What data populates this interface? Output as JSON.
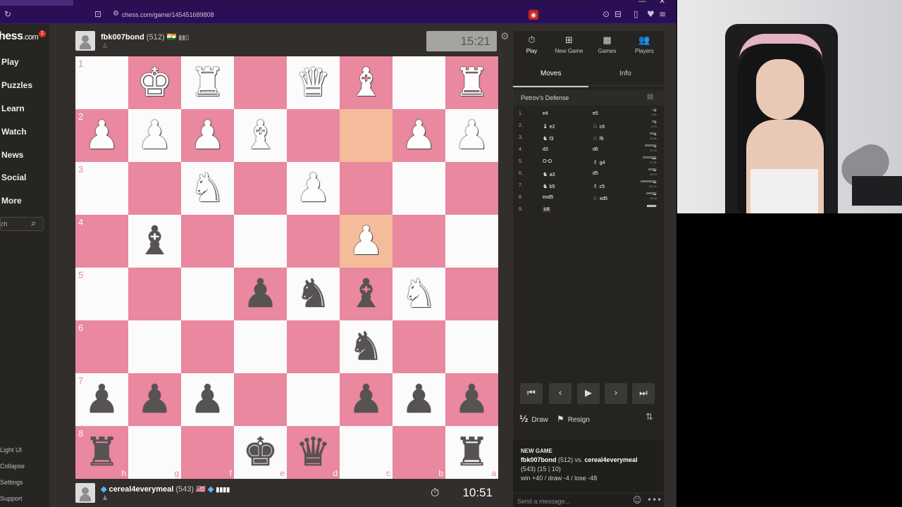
{
  "browser": {
    "url": "chess.com/game/145451689808",
    "window_controls": [
      "—",
      "✕"
    ]
  },
  "sidebar": {
    "logo": "hess",
    "logo_suffix": ".com",
    "notification_count": "1",
    "nav": [
      "Play",
      "Puzzles",
      "Learn",
      "Watch",
      "News",
      "Social",
      "More"
    ],
    "search_placeholder": "ch",
    "footer": [
      "Light UI",
      "Collapse",
      "Settings",
      "Support"
    ]
  },
  "top_player": {
    "name": "fbk007bond",
    "rating": "(512)",
    "flag": "🇮🇳",
    "clock": "15:21"
  },
  "bottom_player": {
    "name": "cereal4everymeal",
    "rating": "(543)",
    "flag": "🇺🇸",
    "clock": "10:51"
  },
  "board": {
    "ranks": [
      "1",
      "2",
      "3",
      "4",
      "5",
      "6",
      "7",
      "8"
    ],
    "files": [
      "h",
      "g",
      "f",
      "e",
      "d",
      "c",
      "b",
      "a"
    ],
    "highlight_squares": [
      [
        1,
        5
      ],
      [
        3,
        5
      ]
    ],
    "pieces": [
      {
        "r": 0,
        "c": 1,
        "p": "♚",
        "color": "w"
      },
      {
        "r": 0,
        "c": 2,
        "p": "♜",
        "color": "w"
      },
      {
        "r": 0,
        "c": 4,
        "p": "♛",
        "color": "w"
      },
      {
        "r": 0,
        "c": 5,
        "p": "♝",
        "color": "w"
      },
      {
        "r": 0,
        "c": 7,
        "p": "♜",
        "color": "w"
      },
      {
        "r": 1,
        "c": 0,
        "p": "♟",
        "color": "w"
      },
      {
        "r": 1,
        "c": 1,
        "p": "♟",
        "color": "w"
      },
      {
        "r": 1,
        "c": 2,
        "p": "♟",
        "color": "w"
      },
      {
        "r": 1,
        "c": 3,
        "p": "♝",
        "color": "w"
      },
      {
        "r": 1,
        "c": 6,
        "p": "♟",
        "color": "w"
      },
      {
        "r": 1,
        "c": 7,
        "p": "♟",
        "color": "w"
      },
      {
        "r": 2,
        "c": 2,
        "p": "♞",
        "color": "w"
      },
      {
        "r": 2,
        "c": 4,
        "p": "♟",
        "color": "w"
      },
      {
        "r": 3,
        "c": 1,
        "p": "♝",
        "color": "b"
      },
      {
        "r": 3,
        "c": 5,
        "p": "♟",
        "color": "w"
      },
      {
        "r": 4,
        "c": 3,
        "p": "♟",
        "color": "b"
      },
      {
        "r": 4,
        "c": 4,
        "p": "♞",
        "color": "b"
      },
      {
        "r": 4,
        "c": 5,
        "p": "♝",
        "color": "b"
      },
      {
        "r": 4,
        "c": 6,
        "p": "♞",
        "color": "w"
      },
      {
        "r": 5,
        "c": 5,
        "p": "♞",
        "color": "b"
      },
      {
        "r": 6,
        "c": 0,
        "p": "♟",
        "color": "b"
      },
      {
        "r": 6,
        "c": 1,
        "p": "♟",
        "color": "b"
      },
      {
        "r": 6,
        "c": 2,
        "p": "♟",
        "color": "b"
      },
      {
        "r": 6,
        "c": 5,
        "p": "♟",
        "color": "b"
      },
      {
        "r": 6,
        "c": 6,
        "p": "♟",
        "color": "b"
      },
      {
        "r": 6,
        "c": 7,
        "p": "♟",
        "color": "b"
      },
      {
        "r": 7,
        "c": 0,
        "p": "♜",
        "color": "b"
      },
      {
        "r": 7,
        "c": 3,
        "p": "♚",
        "color": "b"
      },
      {
        "r": 7,
        "c": 4,
        "p": "♛",
        "color": "b"
      },
      {
        "r": 7,
        "c": 7,
        "p": "♜",
        "color": "b"
      }
    ],
    "colors": {
      "light": "#fbfbfb",
      "dark": "#e9889f",
      "highlight": "#f4bc9a"
    }
  },
  "panel": {
    "tabs": [
      {
        "label": "Play",
        "icon": "⏱"
      },
      {
        "label": "New Game",
        "icon": "⊞"
      },
      {
        "label": "Games",
        "icon": "▦"
      },
      {
        "label": "Players",
        "icon": "👥"
      }
    ],
    "subtabs": [
      "Moves",
      "Info"
    ],
    "opening": "Petrov's Defense",
    "moves": [
      {
        "n": "1.",
        "w": "e4",
        "wf": "",
        "b": "e5",
        "bf": "",
        "t": [
          "2.0s",
          "3.3s"
        ]
      },
      {
        "n": "2.",
        "w": "e2",
        "wf": "♝",
        "b": "c6",
        "bf": "♘",
        "t": [
          "1.3s",
          "8.7s"
        ]
      },
      {
        "n": "3.",
        "w": "f3",
        "wf": "♞",
        "b": "f6",
        "bf": "♘",
        "t": [
          "2.0s",
          "20.8s"
        ]
      },
      {
        "n": "4.",
        "w": "d3",
        "wf": "",
        "b": "d6",
        "bf": "",
        "t": [
          "3.3s",
          "41.4s"
        ]
      },
      {
        "n": "5.",
        "w": "O-O",
        "wf": "",
        "b": "g4",
        "bf": "♗",
        "t": [
          "12.0s",
          "47.8s"
        ]
      },
      {
        "n": "6.",
        "w": "a3",
        "wf": "♞",
        "b": "d5",
        "bf": "",
        "t": [
          "4.9s",
          "25.7s"
        ]
      },
      {
        "n": "7.",
        "w": "b5",
        "wf": "♞",
        "b": "c5",
        "bf": "♗",
        "t": [
          "5.9s",
          "2m 1s"
        ]
      },
      {
        "n": "8.",
        "w": "exd5",
        "wf": "",
        "b": "xd5",
        "bf": "♘",
        "t": [
          "5.1s",
          "35.4s"
        ]
      },
      {
        "n": "9.",
        "w": "c4",
        "wf": "",
        "b": "",
        "bf": "",
        "t": [
          "31.8s"
        ]
      }
    ],
    "controls": [
      "⏮",
      "‹",
      "▶",
      "›",
      "⏭"
    ],
    "draw_label": "Draw",
    "resign_label": "Resign",
    "chat": {
      "heading": "NEW GAME",
      "line1_white": "fbk007bond",
      "line1_mid": " (512) vs. ",
      "line1_black": "cereal4everymeal",
      "line2": "(543) (15 | 10)",
      "line3": "win +40 / draw -4 / lose -48",
      "placeholder": "Send a message..."
    }
  }
}
